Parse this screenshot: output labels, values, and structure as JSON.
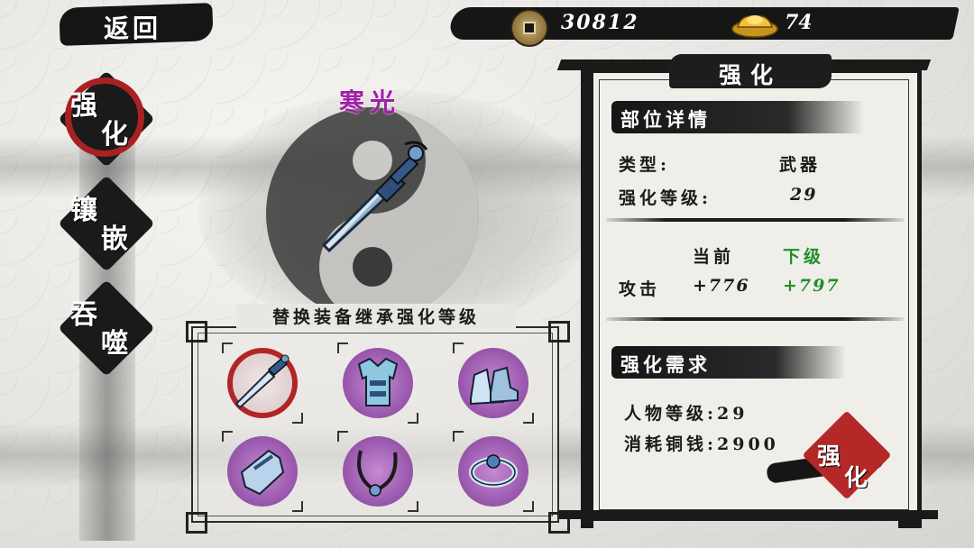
{
  "top_bar": {
    "back_label": "返回",
    "copper": "30812",
    "copper_icon": "copper-coin-icon",
    "gold": "74",
    "gold_icon": "gold-ingot-icon"
  },
  "tabs": [
    {
      "c1": "强",
      "c2": "化",
      "active": true
    },
    {
      "c1": "镶",
      "c2": "嵌",
      "active": false
    },
    {
      "c1": "吞",
      "c2": "噬",
      "active": false
    }
  ],
  "weapon": {
    "name": "寒光",
    "icon": "sword-icon"
  },
  "equipment": {
    "title": "替换装备继承强化等级",
    "slots": [
      {
        "icon": "sword-icon",
        "selected": true
      },
      {
        "icon": "armor-icon",
        "selected": false
      },
      {
        "icon": "boots-icon",
        "selected": false
      },
      {
        "icon": "bracer-icon",
        "selected": false
      },
      {
        "icon": "necklace-icon",
        "selected": false
      },
      {
        "icon": "bracelet-icon",
        "selected": false
      }
    ]
  },
  "panel": {
    "title": "强化",
    "detail_title": "部位详情",
    "type_label": "类型:",
    "type_value": "武器",
    "level_label": "强化等级:",
    "level_value": "29",
    "col_current": "当前",
    "col_next": "下级",
    "attack_label": "攻击",
    "attack_current": "+776",
    "attack_next": "+797",
    "req_title": "强化需求",
    "req_char_level": "人物等级:29",
    "req_copper": "消耗铜钱:2900",
    "button": {
      "c1": "强",
      "c2": "化"
    }
  },
  "colors": {
    "accent_red": "#b32525",
    "weapon_name": "#a01fa6",
    "next_level": "#1f8f2b"
  }
}
